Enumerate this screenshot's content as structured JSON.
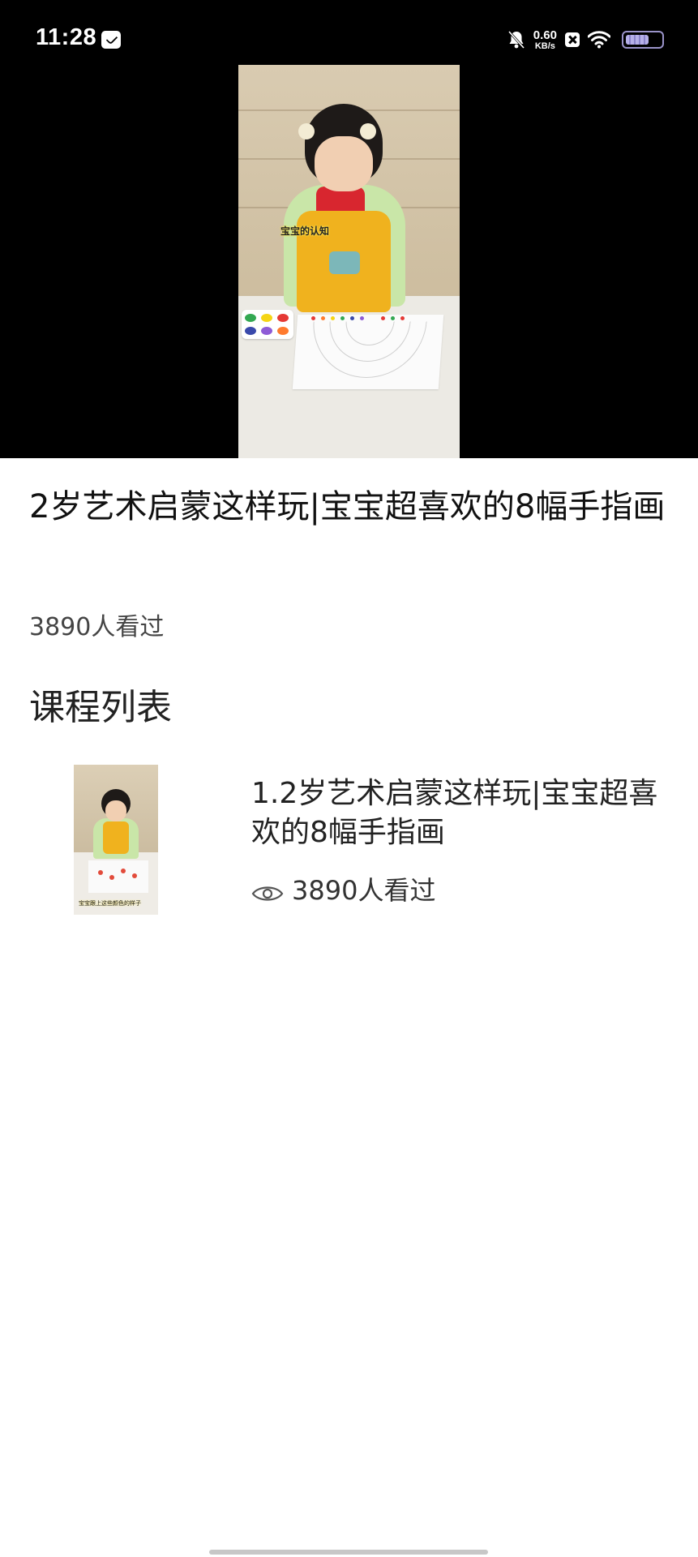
{
  "status_bar": {
    "time": "11:28",
    "net_speed_value": "0.60",
    "net_speed_unit": "KB/s",
    "icons": [
      "message-icon",
      "bell-muted-icon",
      "close-box-icon",
      "wifi-icon",
      "battery-icon"
    ]
  },
  "video": {
    "overlay_subtitle": "宝宝的认知"
  },
  "course": {
    "title": "2岁艺术启蒙这样玩|宝宝超喜欢的8幅手指画",
    "views": "3890人看过"
  },
  "lesson_list": {
    "heading": "课程列表",
    "items": [
      {
        "title": "1.2岁艺术启蒙这样玩|宝宝超喜欢的8幅手指画",
        "views": "3890人看过",
        "thumb_caption": "宝宝跟上这些颜色的样子"
      }
    ]
  },
  "colors": {
    "background": "#ffffff",
    "video_bg": "#000000",
    "text_primary": "#111111",
    "text_secondary": "#444444"
  }
}
